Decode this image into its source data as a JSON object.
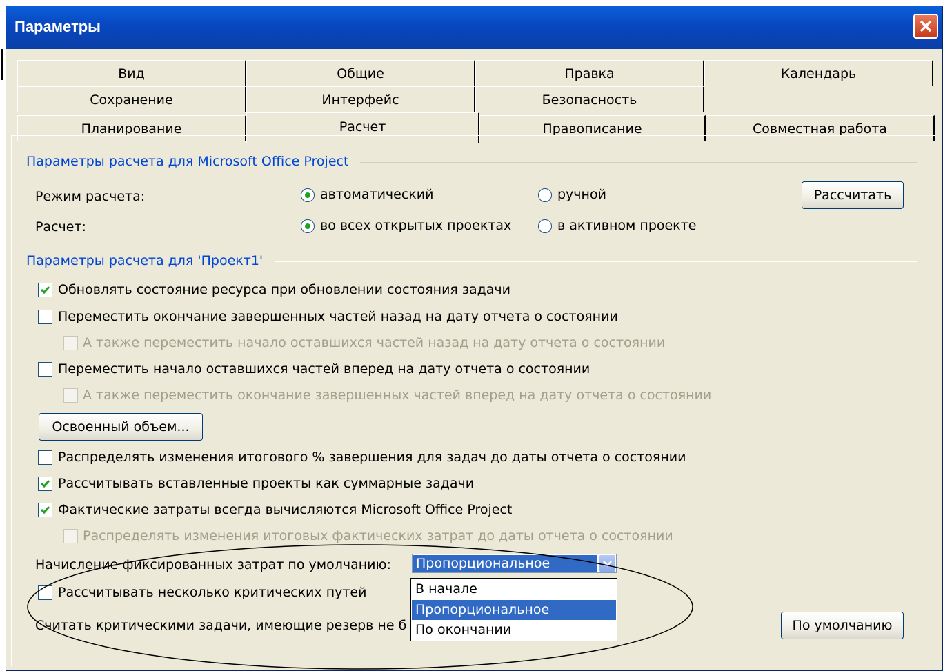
{
  "window": {
    "title": "Параметры"
  },
  "tabs": {
    "row1": [
      "Вид",
      "Общие",
      "Правка",
      "Календарь"
    ],
    "row2": [
      "Сохранение",
      "Интерфейс",
      "Безопасность"
    ],
    "row3": [
      "Планирование",
      "Расчет",
      "Правописание",
      "Совместная работа"
    ],
    "active": "Расчет"
  },
  "group1": {
    "title": "Параметры расчета для Microsoft Office Project",
    "mode_label": "Режим расчета:",
    "mode_auto": "автоматический",
    "mode_manual": "ручной",
    "mode_selected": "автоматический",
    "calc_label": "Расчет:",
    "calc_all": "во всех открытых проектах",
    "calc_active": "в активном проекте",
    "calc_selected": "во всех открытых проектах",
    "calculate_button": "Рассчитать"
  },
  "group2": {
    "title": "Параметры расчета для 'Проект1'",
    "opt1": {
      "label": "Обновлять состояние ресурса при обновлении состояния задачи",
      "checked": true
    },
    "opt2": {
      "label": "Переместить окончание завершенных частей назад на дату отчета о состоянии",
      "checked": false
    },
    "opt2a": {
      "label": "А также переместить начало оставшихся частей назад на дату отчета о состоянии",
      "checked": false,
      "disabled": true
    },
    "opt3": {
      "label": "Переместить начало оставшихся частей вперед на дату отчета о состоянии",
      "checked": false
    },
    "opt3a": {
      "label": "А также переместить окончание завершенных частей вперед на дату отчета о состоянии",
      "checked": false,
      "disabled": true
    },
    "earned_value_button": "Освоенный объем...",
    "opt4": {
      "label": "Распределять изменения итогового % завершения для задач до даты отчета о состоянии",
      "checked": false
    },
    "opt5": {
      "label": "Рассчитывать вставленные проекты как суммарные задачи",
      "checked": true
    },
    "opt6": {
      "label": "Фактические затраты всегда вычисляются Microsoft Office Project",
      "checked": true
    },
    "opt6a": {
      "label": "Распределять изменения итоговых фактических затрат до даты отчета о состоянии",
      "checked": false,
      "disabled": true
    },
    "fixed_cost_label": "Начисление фиксированных затрат по умолчанию:",
    "fixed_cost_value": "Пропорциональное",
    "fixed_cost_options": [
      "В начале",
      "Пропорциональное",
      "По окончании"
    ],
    "opt7": {
      "label": "Рассчитывать несколько критических путей",
      "checked": false
    },
    "critical_label": "Считать критическими задачи, имеющие резерв не б",
    "default_button": "По умолчанию"
  },
  "colors": {
    "title_bar": "#0a4fd0",
    "group_title": "#0046d5",
    "selection": "#316ac5",
    "dialog_bg": "#ece9d8"
  }
}
